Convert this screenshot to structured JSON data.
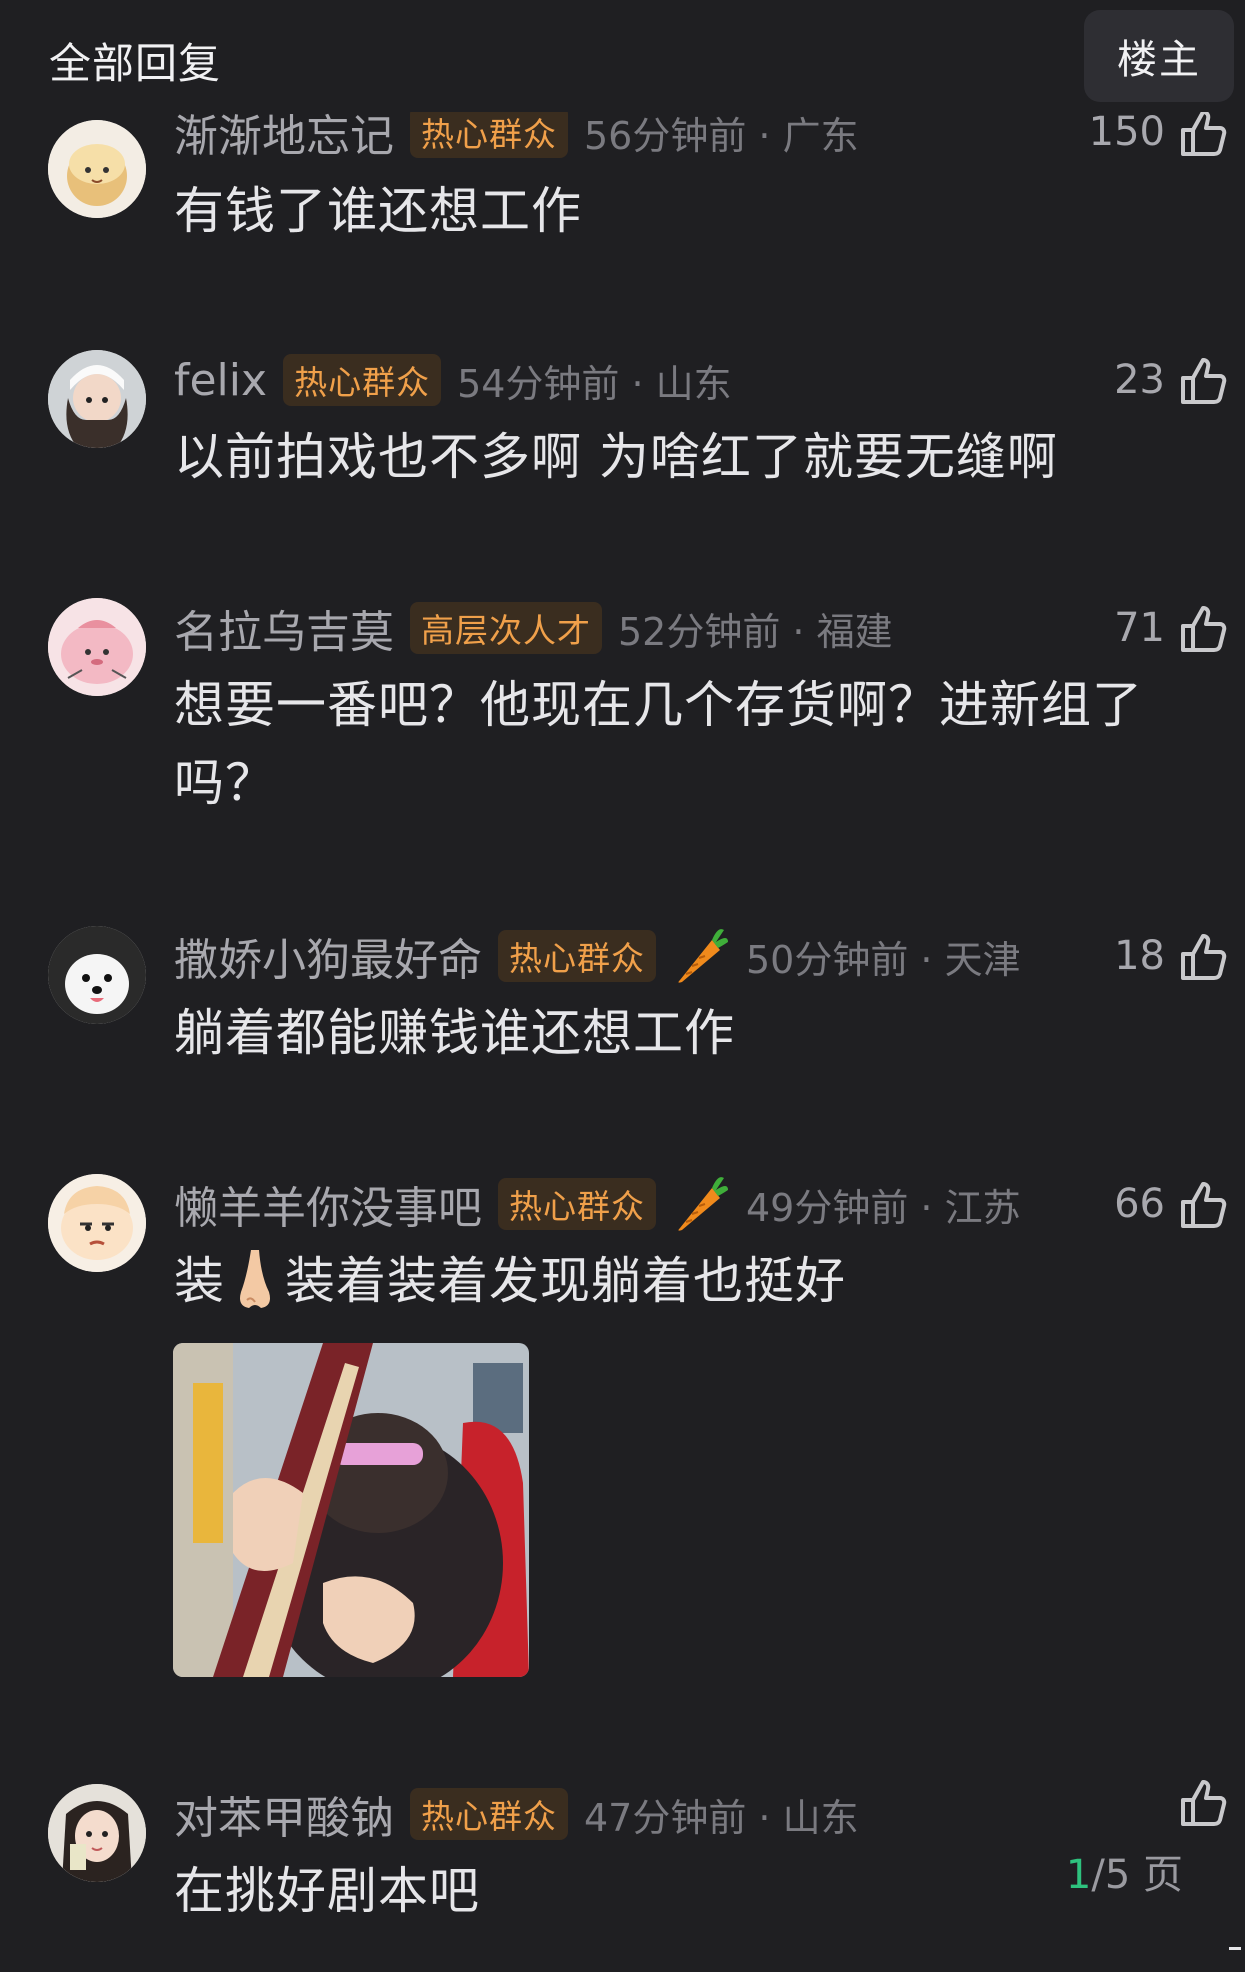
{
  "header": {
    "title": "全部回复",
    "op_label": "楼主"
  },
  "comments": [
    {
      "username": "渐渐地忘记",
      "badge": "热心群众",
      "time_loc": "56分钟前 · 广东",
      "likes": "150",
      "content": "有钱了谁还想工作"
    },
    {
      "username": "felix",
      "badge": "热心群众",
      "time_loc": "54分钟前 · 山东",
      "likes": "23",
      "content": "以前拍戏也不多啊  为啥红了就要无缝啊"
    },
    {
      "username": "名拉乌吉莫",
      "badge": "高层次人才",
      "time_loc": "52分钟前 · 福建",
      "likes": "71",
      "content": "想要一番吧？他现在几个存货啊？进新组了吗？"
    },
    {
      "username": "撒娇小狗最好命",
      "badge": "热心群众",
      "time_loc": "50分钟前 · 天津",
      "likes": "18",
      "content": "躺着都能赚钱谁还想工作"
    },
    {
      "username": "懒羊羊你没事吧",
      "badge": "热心群众",
      "time_loc": "49分钟前 · 江苏",
      "likes": "66",
      "content_pre": "装",
      "content_post": "装着装着发现躺着也挺好"
    },
    {
      "username": "对苯甲酸钠",
      "badge": "热心群众",
      "time_loc": "47分钟前 · 山东",
      "likes": "",
      "content": "在挑好剧本吧"
    }
  ],
  "pagination": {
    "current": "1",
    "rest": "/5 页"
  },
  "colors": {
    "background": "#1f1f22",
    "badge_text": "#f0a04a",
    "badge_bg": "#3a2d1f",
    "page_current": "#2ec27e"
  },
  "icons": {
    "like": "thumbs-up-icon",
    "carrot": "carrot-icon",
    "nose": "nose-emoji"
  }
}
